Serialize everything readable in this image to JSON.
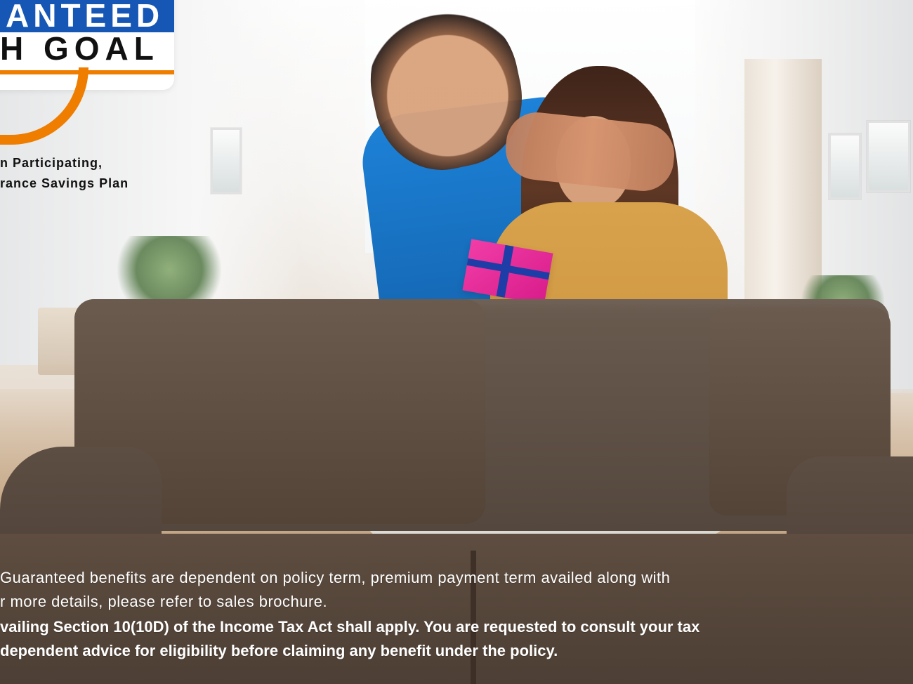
{
  "logo": {
    "top_text": "ANTEED",
    "main_text": "H GOAL"
  },
  "tagline": {
    "line1": "n Participating,",
    "line2": "rance Savings Plan"
  },
  "disclaimer": {
    "line1": "Guaranteed benefits are dependent on policy term, premium payment term availed along with",
    "line2": "r more details, please refer to sales brochure.",
    "line3": "vailing Section 10(10D) of the Income Tax Act shall apply. You are requested to consult your tax",
    "line4": "dependent advice for eligibility before claiming any benefit under the policy."
  },
  "colors": {
    "brand_blue": "#1657b5",
    "brand_orange": "#ef7d00",
    "shirt_blue": "#1d82d8",
    "sweater_mustard": "#d8a24d",
    "gift_pink": "#e62f98",
    "sofa_brown": "#5e4d40"
  }
}
